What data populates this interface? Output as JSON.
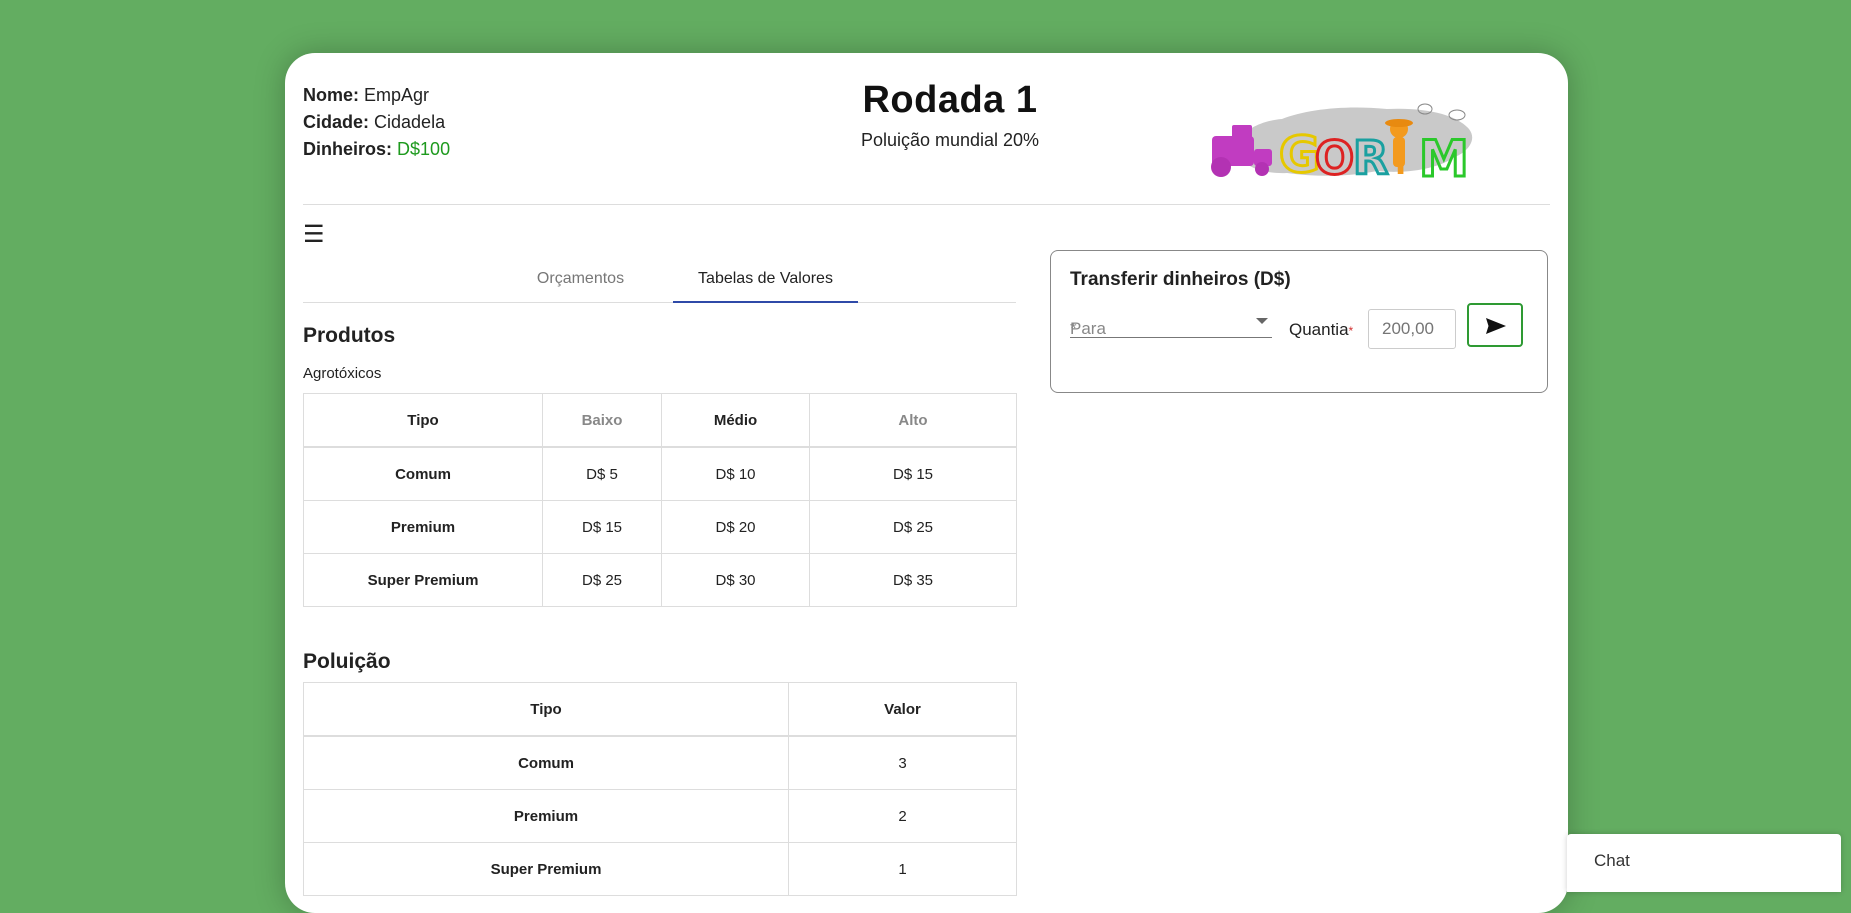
{
  "player": {
    "name_label": "Nome:",
    "name_value": "EmpAgr",
    "city_label": "Cidade:",
    "city_value": "Cidadela",
    "money_label": "Dinheiros:",
    "money_value": "D$100"
  },
  "round": {
    "title": "Rodada 1",
    "pollution": "Poluição mundial 20%"
  },
  "logo": {
    "letters": [
      "G",
      "O",
      "R",
      "I",
      "M"
    ]
  },
  "menu_icon": "menu-icon",
  "tabs": [
    {
      "label": "Orçamentos",
      "active": false
    },
    {
      "label": "Tabelas de Valores",
      "active": true
    }
  ],
  "produtos": {
    "heading": "Produtos",
    "subheading": "Agrotóxicos",
    "columns": [
      "Tipo",
      "Baixo",
      "Médio",
      "Alto"
    ],
    "rows": [
      {
        "tipo": "Comum",
        "baixo": "D$ 5",
        "medio": "D$ 10",
        "alto": "D$ 15"
      },
      {
        "tipo": "Premium",
        "baixo": "D$ 15",
        "medio": "D$ 20",
        "alto": "D$ 25"
      },
      {
        "tipo": "Super Premium",
        "baixo": "D$ 25",
        "medio": "D$ 30",
        "alto": "D$ 35"
      }
    ]
  },
  "poluicao": {
    "heading": "Poluição",
    "columns": [
      "Tipo",
      "Valor"
    ],
    "rows": [
      {
        "tipo": "Comum",
        "valor": "3"
      },
      {
        "tipo": "Premium",
        "valor": "2"
      },
      {
        "tipo": "Super Premium",
        "valor": "1"
      }
    ]
  },
  "transfer": {
    "title": "Transferir dinheiros (D$)",
    "to_label": "Para",
    "required_mark": "*",
    "amount_label": "Quantia",
    "amount_placeholder": "200,00",
    "send_icon": "send-icon"
  },
  "chat": {
    "label": "Chat"
  },
  "colors": {
    "background": "#63ad61",
    "money": "#1e9a1e",
    "active_tab": "#2f4aa8",
    "send_border": "#2e9a33"
  }
}
